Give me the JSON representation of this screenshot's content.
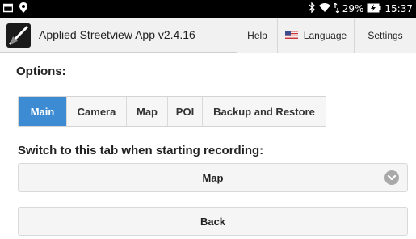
{
  "status_bar": {
    "battery_percent": "29%",
    "time": "15:37",
    "icons": [
      "window-icon",
      "location-pin-icon",
      "bluetooth-icon",
      "wifi-icon",
      "data-arrows-icon",
      "battery-charging-icon"
    ]
  },
  "app_bar": {
    "title": "Applied Streetview App v2.4.16",
    "logo_icon": "streetview-logo-icon",
    "help_label": "Help",
    "language_label": "Language",
    "language_icon": "us-flag-icon",
    "settings_label": "Settings"
  },
  "options_label": "Options:",
  "tabs": [
    {
      "label": "Main",
      "active": true
    },
    {
      "label": "Camera",
      "active": false
    },
    {
      "label": "Map",
      "active": false
    },
    {
      "label": "POI",
      "active": false
    },
    {
      "label": "Backup and Restore",
      "active": false
    }
  ],
  "switch_label": "Switch to this tab when starting recording:",
  "select": {
    "value": "Map",
    "icon": "chevron-down-circle-icon"
  },
  "back_label": "Back",
  "colors": {
    "active_tab": "#3d8bd3",
    "status_bar": "#000000",
    "app_bar": "#f1f1f1"
  }
}
